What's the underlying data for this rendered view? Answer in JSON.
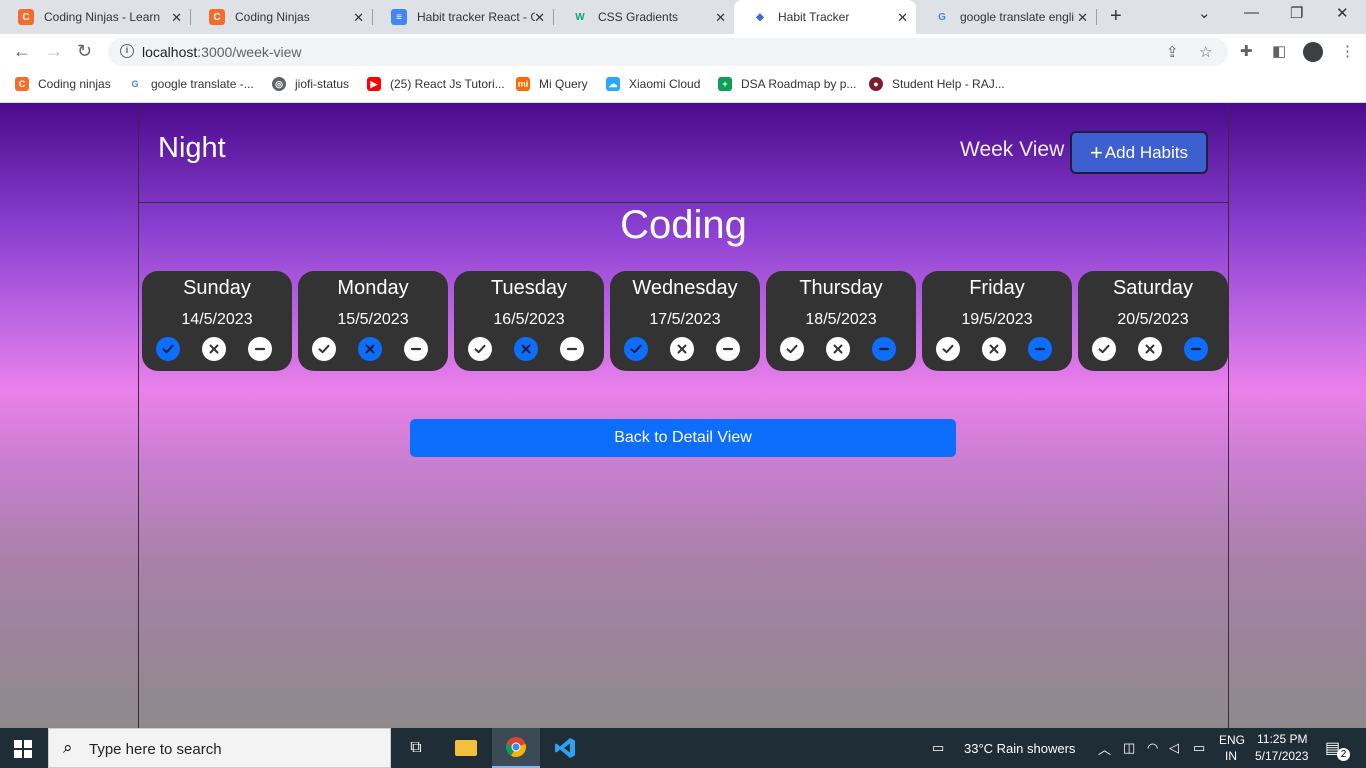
{
  "tabs": [
    {
      "title": "Coding Ninjas - Learn",
      "favicon": "coding-ninjas-icon",
      "active": false
    },
    {
      "title": "Coding Ninjas",
      "favicon": "coding-ninjas-icon",
      "active": false
    },
    {
      "title": "Habit tracker React - G",
      "favicon": "google-docs-icon",
      "active": false
    },
    {
      "title": "CSS Gradients",
      "favicon": "w3-icon",
      "active": false
    },
    {
      "title": "Habit Tracker",
      "favicon": "react-icon",
      "active": true
    },
    {
      "title": "google translate engli",
      "favicon": "google-icon",
      "active": false
    }
  ],
  "address": {
    "host": "localhost",
    "path": ":3000/week-view"
  },
  "bookmarks": [
    {
      "label": "Coding ninjas",
      "icon": "coding-ninjas-icon"
    },
    {
      "label": "google translate -...",
      "icon": "google-icon"
    },
    {
      "label": "jiofi-status",
      "icon": "globe-icon"
    },
    {
      "label": "(25) React Js Tutori...",
      "icon": "youtube-icon"
    },
    {
      "label": "Mi Query",
      "icon": "mi-icon"
    },
    {
      "label": "Xiaomi Cloud",
      "icon": "cloud-icon"
    },
    {
      "label": "DSA Roadmap by p...",
      "icon": "sheets-icon"
    },
    {
      "label": "Student Help - RAJ...",
      "icon": "student-help-icon"
    }
  ],
  "app": {
    "brand": "Night",
    "week_view_link": "Week View",
    "add_habits_label": "Add Habits",
    "habit_title": "Coding",
    "back_button": "Back to Detail View",
    "status_legend": [
      "done",
      "not-done",
      "none"
    ],
    "days": [
      {
        "name": "Sunday",
        "date": "14/5/2023",
        "status": "done"
      },
      {
        "name": "Monday",
        "date": "15/5/2023",
        "status": "not-done"
      },
      {
        "name": "Tuesday",
        "date": "16/5/2023",
        "status": "not-done"
      },
      {
        "name": "Wednesday",
        "date": "17/5/2023",
        "status": "done"
      },
      {
        "name": "Thursday",
        "date": "18/5/2023",
        "status": "none"
      },
      {
        "name": "Friday",
        "date": "19/5/2023",
        "status": "none"
      },
      {
        "name": "Saturday",
        "date": "20/5/2023",
        "status": "none"
      }
    ],
    "colors": {
      "accent": "#0d6efd",
      "card": "#333333",
      "add_button": "#3d5fd0"
    }
  },
  "taskbar": {
    "search_placeholder": "Type here to search",
    "weather": "33°C  Rain showers",
    "lang_top": "ENG",
    "lang_bottom": "IN",
    "time": "11:25 PM",
    "date": "5/17/2023",
    "notifications": "2"
  }
}
